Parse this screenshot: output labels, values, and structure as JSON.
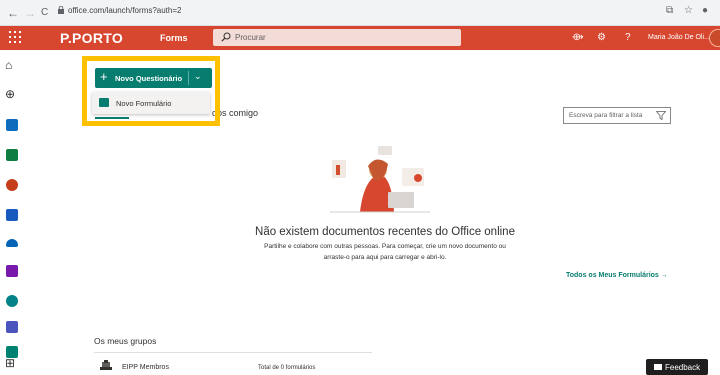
{
  "browser": {
    "back": "←",
    "forward": "→",
    "reload": "C",
    "url": "office.com/launch/forms?auth=2"
  },
  "suite": {
    "brand": "P.PORTO",
    "app": "Forms",
    "search_placeholder": "Procurar",
    "user": "Maria João De Oli..."
  },
  "toolbar": {
    "new_label": "Novo Questionário",
    "dropdown_item": "Novo Formulário",
    "tab_partial": "dos comigo",
    "filter_placeholder": "Escreva para filtrar a lista"
  },
  "empty": {
    "title": "Não existem documentos recentes do Office online",
    "desc_line1": "Partilhe e colabore com outras pessoas. Para começar, crie um novo documento ou",
    "desc_line2": "arraste-o para aqui para carregar e abri-lo.",
    "all_forms": "Todos os Meus Formulários →"
  },
  "groups": {
    "title": "Os meus grupos",
    "items": [
      {
        "name": "EIPP Membros",
        "total": "Total de 0 formulários"
      }
    ]
  },
  "feedback": "Feedback",
  "colors": {
    "suite_bar": "#d7472f",
    "forms_accent": "#077d6f",
    "highlight": "#ffc000"
  },
  "icons": {
    "rail": [
      "home-icon",
      "create-icon",
      "outlook-icon",
      "excel-icon",
      "powerpoint-icon",
      "word-icon",
      "onedrive-icon",
      "onenote-icon",
      "sharepoint-icon",
      "teams-icon",
      "sway-icon",
      "all-apps-icon"
    ]
  }
}
